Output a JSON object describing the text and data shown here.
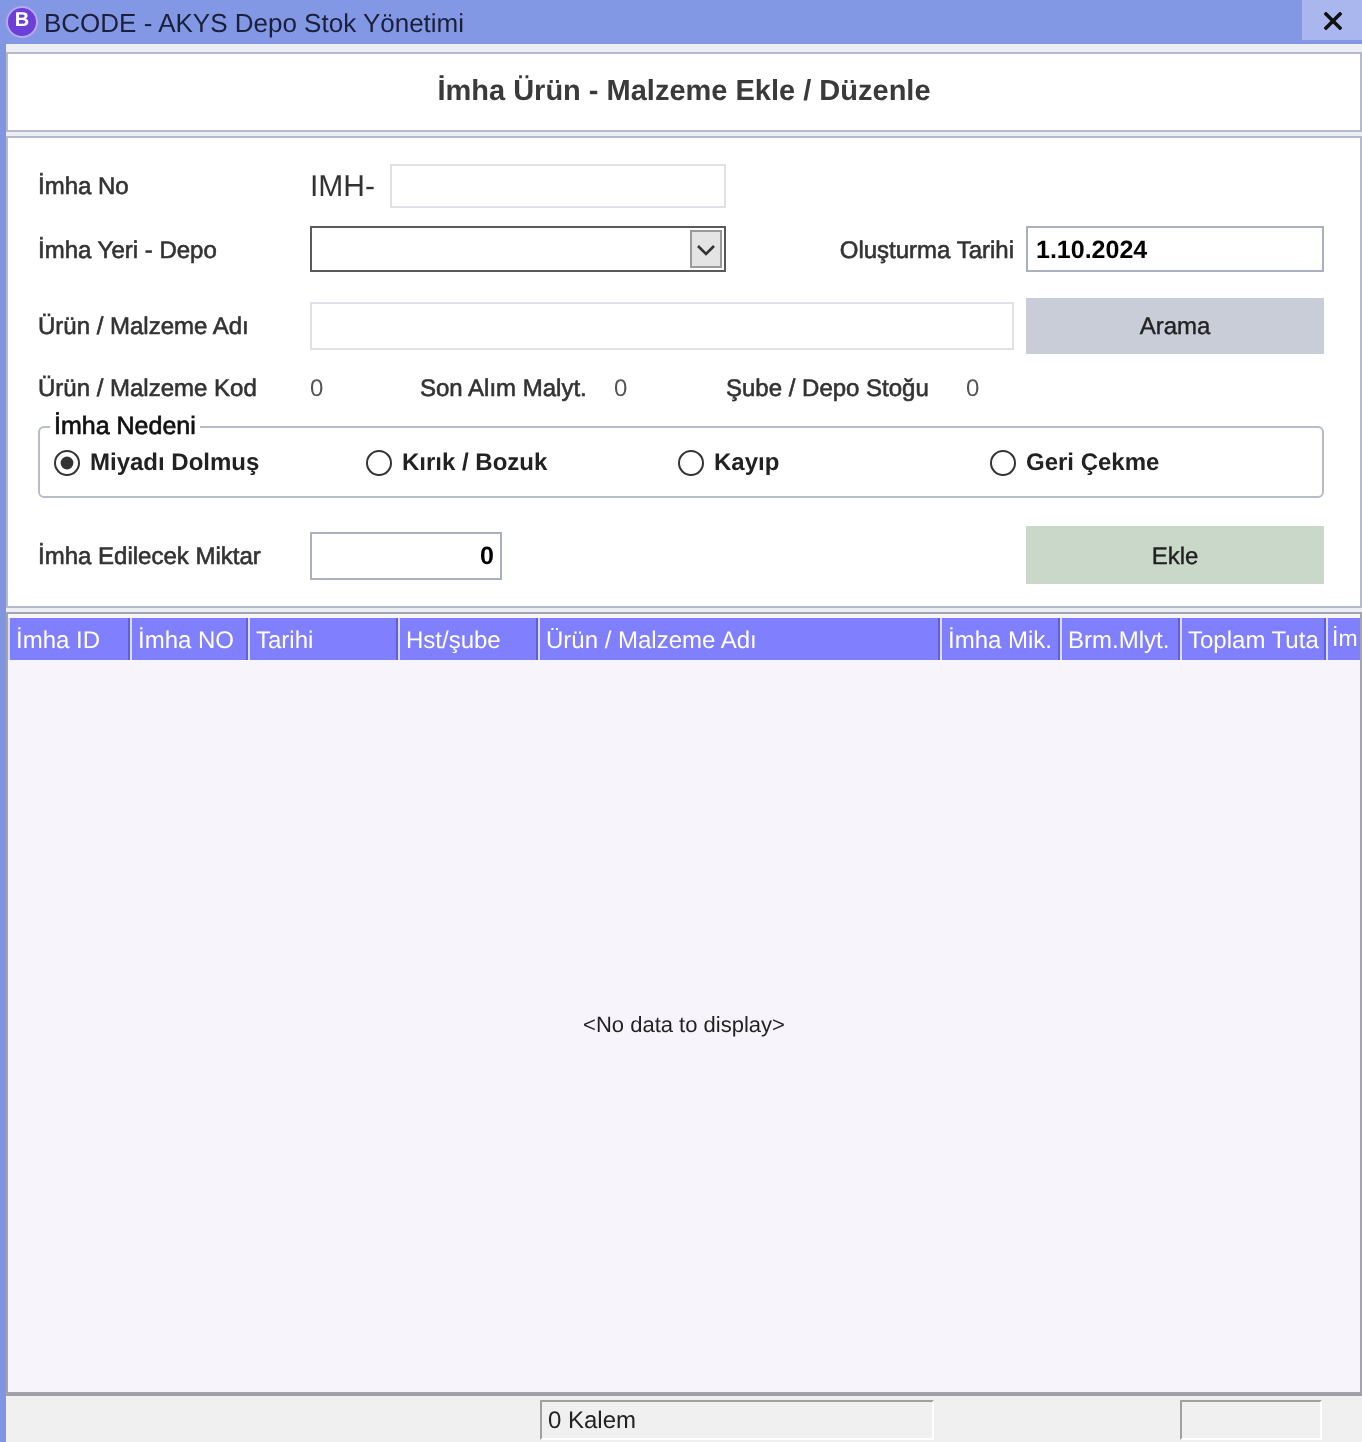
{
  "window": {
    "logo": "B",
    "title": "BCODE - AKYS Depo Stok Yönetimi"
  },
  "header": {
    "title": "İmha Ürün - Malzeme Ekle / Düzenle"
  },
  "form": {
    "imha_no": {
      "label": "İmha No",
      "prefix": "IMH-"
    },
    "location": {
      "label": "İmha Yeri - Depo"
    },
    "created_date": {
      "label": "Oluşturma Tarihi",
      "value": "1.10.2024"
    },
    "product_name": {
      "label": "Ürün / Malzeme Adı"
    },
    "search_button": {
      "label": "Arama"
    },
    "info": [
      {
        "label": "Ürün / Malzeme Kod",
        "value": "0"
      },
      {
        "label": "Son Alım Malyt.",
        "value": "0"
      },
      {
        "label": "Şube / Depo Stoğu",
        "value": "0"
      }
    ],
    "reason": {
      "legend": "İmha Nedeni",
      "options": [
        {
          "label": "Miyadı Dolmuş",
          "selected": true
        },
        {
          "label": "Kırık / Bozuk",
          "selected": false
        },
        {
          "label": "Kayıp",
          "selected": false
        },
        {
          "label": "Geri Çekme",
          "selected": false
        }
      ]
    },
    "quantity": {
      "label": "İmha Edilecek Miktar",
      "value": "0"
    },
    "add_button": {
      "label": "Ekle"
    }
  },
  "table": {
    "columns": [
      "İmha ID",
      "İmha NO",
      "Tarihi",
      "Hst/şube",
      "Ürün / Malzeme Adı",
      "İmha Mik.",
      "Brm.Mlyt.",
      "Toplam Tuta",
      "İm"
    ],
    "empty_text": "<No data to display>"
  },
  "status_bar": {
    "panels": [
      "0 Kalem"
    ]
  }
}
